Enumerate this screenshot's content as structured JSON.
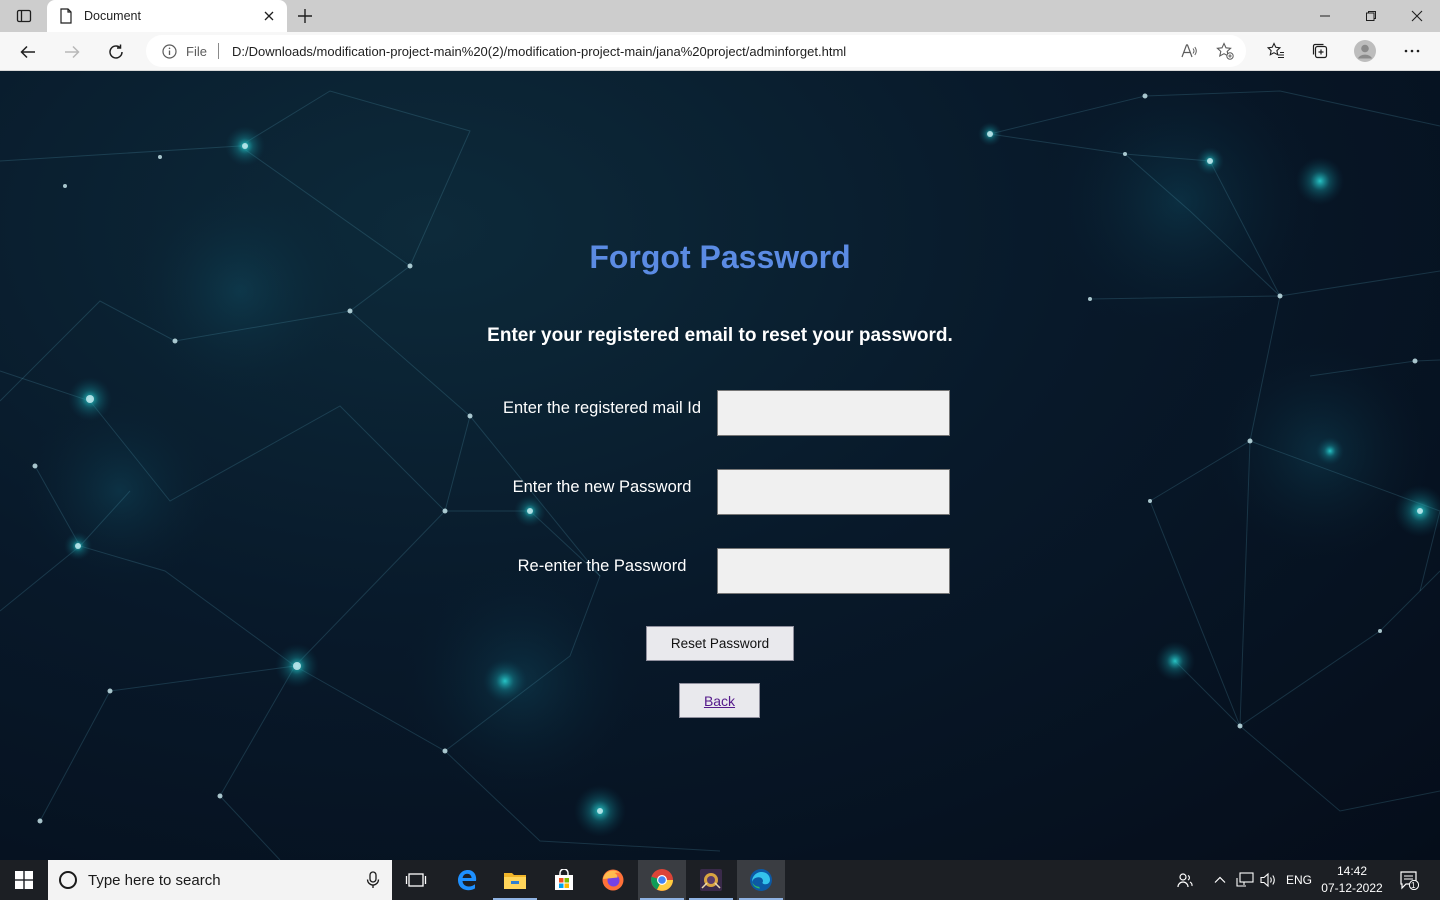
{
  "browser": {
    "tab_title": "Document",
    "address_scheme": "File",
    "url": "D:/Downloads/modification-project-main%20(2)/modification-project-main/jana%20project/adminforget.html"
  },
  "page": {
    "heading": "Forgot Password",
    "subtitle": "Enter your registered email to reset your password.",
    "fields": [
      {
        "label": "Enter the registered mail Id",
        "value": ""
      },
      {
        "label": "Enter the new Password",
        "value": ""
      },
      {
        "label": "Re-enter the Password",
        "value": ""
      }
    ],
    "reset_button": "Reset Password",
    "back_link": "Back"
  },
  "taskbar": {
    "search_placeholder": "Type here to search",
    "language": "ENG",
    "time": "14:42",
    "date": "07-12-2022",
    "notification_count": "1"
  },
  "colors": {
    "heading": "#5b8be3",
    "page_background": "#08192a",
    "node_glow": "#2ad6d6"
  }
}
